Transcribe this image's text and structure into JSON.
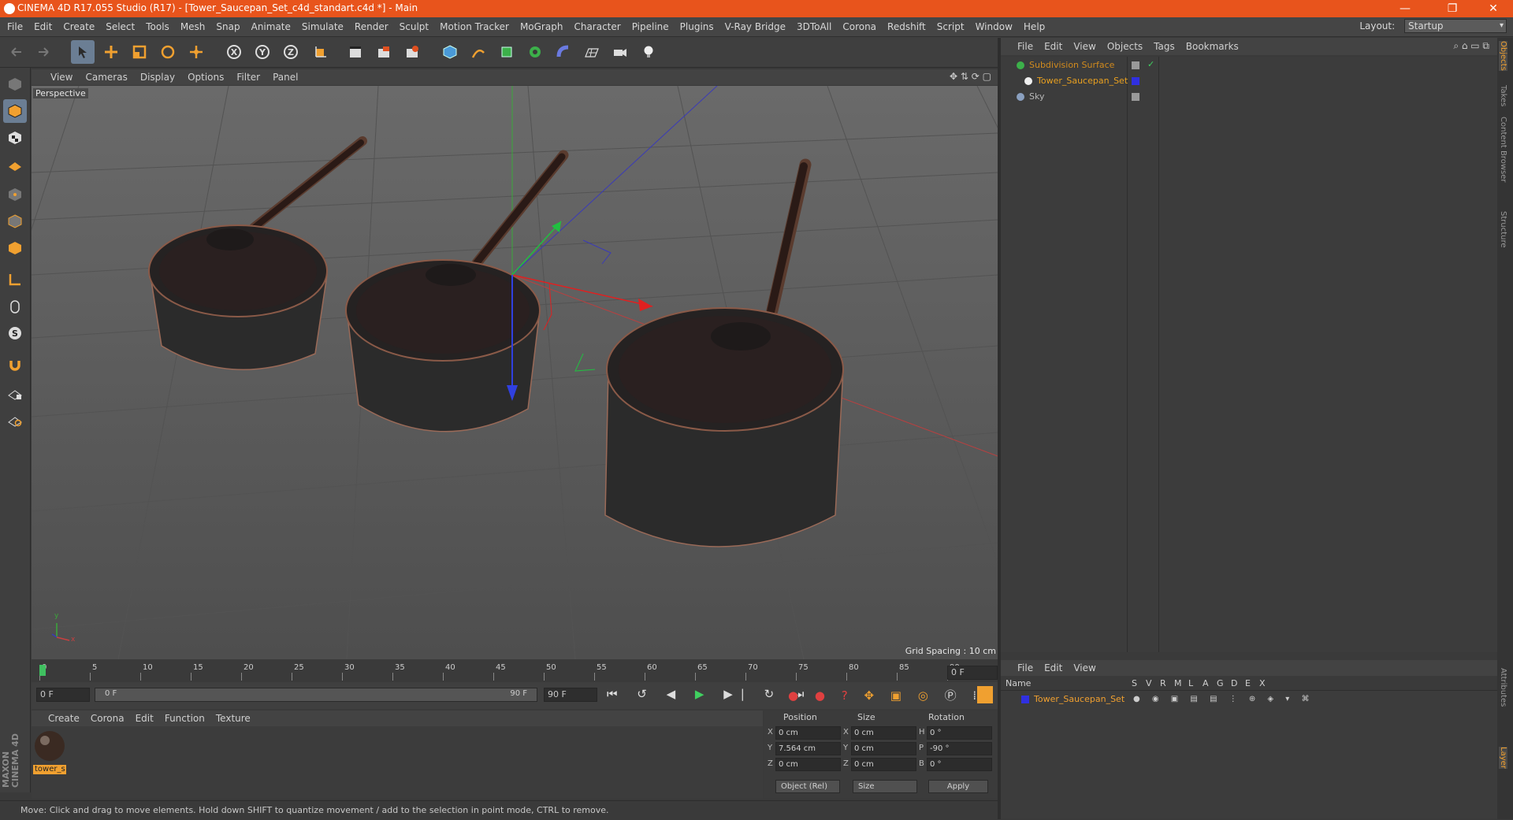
{
  "window": {
    "title": "CINEMA 4D R17.055 Studio (R17) - [Tower_Saucepan_Set_c4d_standart.c4d *] - Main"
  },
  "menu": [
    "File",
    "Edit",
    "Create",
    "Select",
    "Tools",
    "Mesh",
    "Snap",
    "Animate",
    "Simulate",
    "Render",
    "Sculpt",
    "Motion Tracker",
    "MoGraph",
    "Character",
    "Pipeline",
    "Plugins",
    "V-Ray Bridge",
    "3DToAll",
    "Corona",
    "Redshift",
    "Script",
    "Window",
    "Help"
  ],
  "layout": {
    "label": "Layout:",
    "value": "Startup"
  },
  "viewport": {
    "menu": [
      "View",
      "Cameras",
      "Display",
      "Options",
      "Filter",
      "Panel"
    ],
    "label": "Perspective",
    "grid_spacing": "Grid Spacing : 10 cm",
    "axis_x": "x",
    "axis_y": "y"
  },
  "timeline": {
    "ticks": [
      "0",
      "5",
      "10",
      "15",
      "20",
      "25",
      "30",
      "35",
      "40",
      "45",
      "50",
      "55",
      "60",
      "65",
      "70",
      "75",
      "80",
      "85",
      "90"
    ],
    "current_frame": "0 F",
    "start": "0 F",
    "range_start": "0 F",
    "range_end": "90 F",
    "end": "90 F"
  },
  "materials": {
    "menu": [
      "Create",
      "Corona",
      "Edit",
      "Function",
      "Texture"
    ],
    "items": [
      {
        "label": "tower_s"
      }
    ]
  },
  "coordinates": {
    "headers": {
      "position": "Position",
      "size": "Size",
      "rotation": "Rotation"
    },
    "rows": [
      {
        "axis": "X",
        "pos": "0 cm",
        "saxis": "X",
        "size": "0 cm",
        "raxis": "H",
        "rot": "0 °"
      },
      {
        "axis": "Y",
        "pos": "7.564 cm",
        "saxis": "Y",
        "size": "0 cm",
        "raxis": "P",
        "rot": "-90 °"
      },
      {
        "axis": "Z",
        "pos": "0 cm",
        "saxis": "Z",
        "size": "0 cm",
        "raxis": "B",
        "rot": "0 °"
      }
    ],
    "mode": "Object (Rel)",
    "size_mode": "Size",
    "apply": "Apply"
  },
  "status": "Move: Click and drag to move elements. Hold down SHIFT to quantize movement / add to the selection in point mode, CTRL to remove.",
  "object_manager": {
    "menu": [
      "File",
      "Edit",
      "View",
      "Objects",
      "Tags",
      "Bookmarks"
    ],
    "objects": [
      {
        "name": "Subdivision Surface",
        "color": "#d08a1e"
      },
      {
        "name": "Tower_Saucepan_Set",
        "color": "#e8a020"
      },
      {
        "name": "Sky",
        "color": "#b8b8b8"
      }
    ]
  },
  "layer_manager": {
    "menu": [
      "File",
      "Edit",
      "View"
    ],
    "columns": [
      "Name",
      "S",
      "V",
      "R",
      "M",
      "L",
      "A",
      "G",
      "D",
      "E",
      "X"
    ],
    "layers": [
      {
        "name": "Tower_Saucepan_Set",
        "color": "#3030e0"
      }
    ]
  },
  "side_tabs": [
    "Objects",
    "Takes",
    "Content Browser",
    "Structure",
    "Attributes",
    "Layer"
  ],
  "branding": {
    "line1": "MAXON",
    "line2": "CINEMA 4D"
  },
  "colors": {
    "title_bar": "#e8541c",
    "accent": "#f0a030",
    "active_tool": "#6b7e94"
  }
}
